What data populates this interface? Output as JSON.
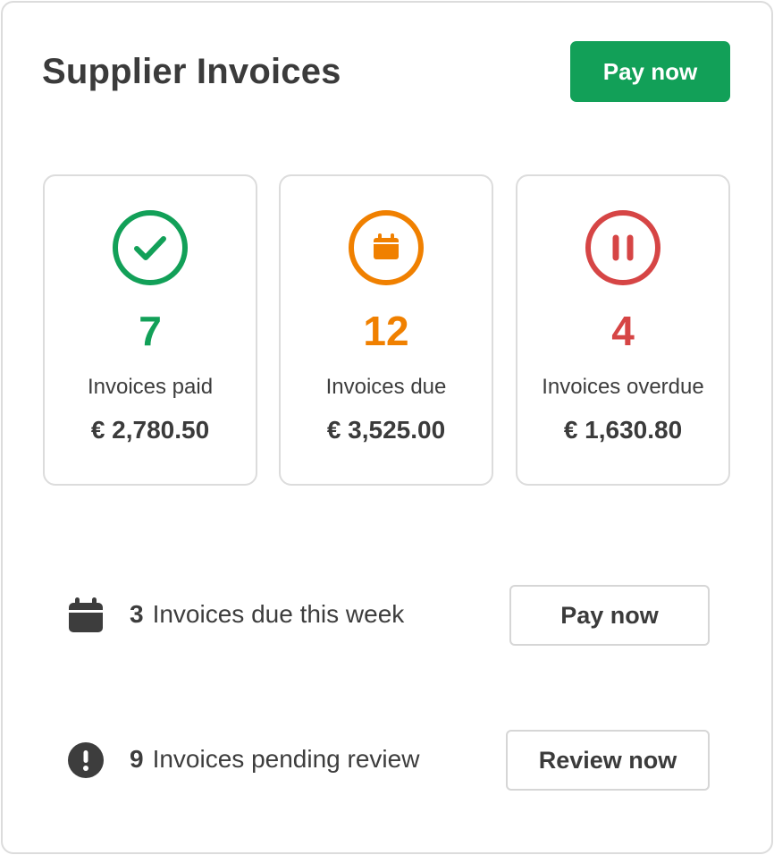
{
  "header": {
    "title": "Supplier Invoices",
    "pay_now_label": "Pay now"
  },
  "stats": [
    {
      "count": "7",
      "label": "Invoices paid",
      "amount": "€ 2,780.50",
      "icon": "check-circle-icon",
      "color": "#12a058"
    },
    {
      "count": "12",
      "label": "Invoices due",
      "amount": "€ 3,525.00",
      "icon": "calendar-circle-icon",
      "color": "#f08000"
    },
    {
      "count": "4",
      "label": "Invoices overdue",
      "amount": "€ 1,630.80",
      "icon": "pause-circle-icon",
      "color": "#d64545"
    }
  ],
  "actions": [
    {
      "count": "3",
      "text": "Invoices due this week",
      "button_label": "Pay now",
      "icon": "calendar-icon"
    },
    {
      "count": "9",
      "text": "Invoices pending review",
      "button_label": "Review now",
      "icon": "exclamation-circle-icon"
    }
  ]
}
